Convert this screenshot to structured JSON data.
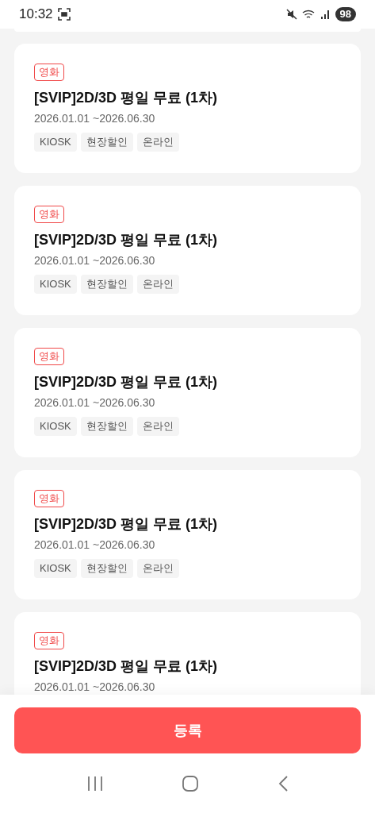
{
  "status_bar": {
    "time": "10:32",
    "battery": "98"
  },
  "coupons": [
    {
      "category": "영화",
      "title": "[SVIP]2D/3D 평일 무료 (1차)",
      "period": "2026.01.01 ~2026.06.30",
      "tags": [
        "KIOSK",
        "현장할인",
        "온라인"
      ]
    },
    {
      "category": "영화",
      "title": "[SVIP]2D/3D 평일 무료 (1차)",
      "period": "2026.01.01 ~2026.06.30",
      "tags": [
        "KIOSK",
        "현장할인",
        "온라인"
      ]
    },
    {
      "category": "영화",
      "title": "[SVIP]2D/3D 평일 무료 (1차)",
      "period": "2026.01.01 ~2026.06.30",
      "tags": [
        "KIOSK",
        "현장할인",
        "온라인"
      ]
    },
    {
      "category": "영화",
      "title": "[SVIP]2D/3D 평일 무료 (1차)",
      "period": "2026.01.01 ~2026.06.30",
      "tags": [
        "KIOSK",
        "현장할인",
        "온라인"
      ]
    },
    {
      "category": "영화",
      "title": "[SVIP]2D/3D 평일 무료 (1차)",
      "period": "2026.01.01 ~2026.06.30"
    }
  ],
  "submit_button": "등록"
}
